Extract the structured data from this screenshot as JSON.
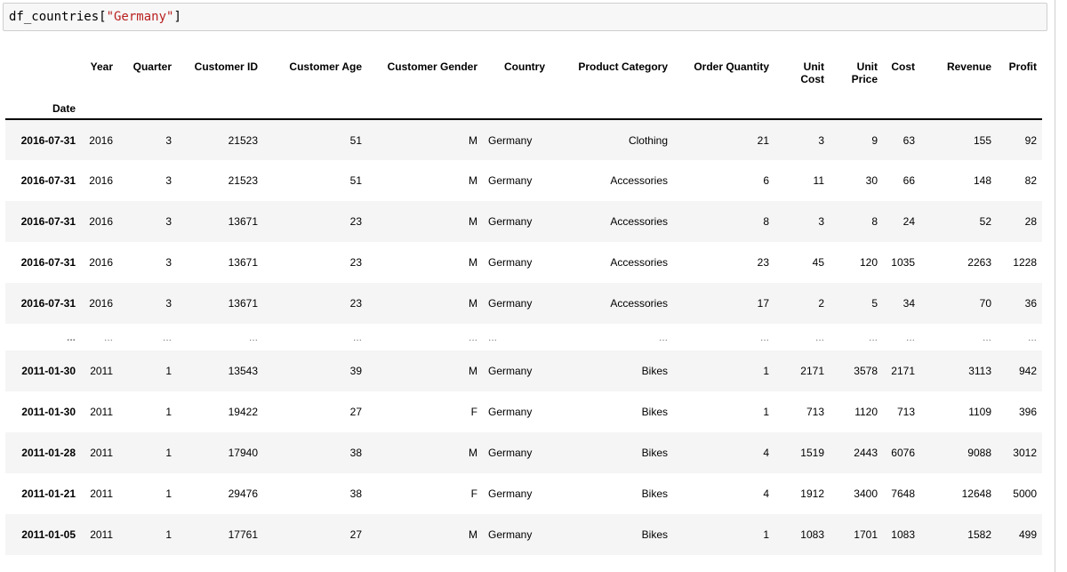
{
  "cell": {
    "code_prefix": "df_countries[",
    "code_string": "\"Germany\"",
    "code_suffix": "]"
  },
  "table": {
    "index_name": "Date",
    "columns": [
      "Year",
      "Quarter",
      "Customer ID",
      "Customer Age",
      "Customer Gender",
      "Country",
      "Product Category",
      "Order Quantity",
      "Unit Cost",
      "Unit Price",
      "Cost",
      "Revenue",
      "Profit"
    ],
    "rows": [
      {
        "date": "2016-07-31",
        "cells": [
          "2016",
          "3",
          "21523",
          "51",
          "M",
          "Germany",
          "Clothing",
          "21",
          "3",
          "9",
          "63",
          "155",
          "92"
        ]
      },
      {
        "date": "2016-07-31",
        "cells": [
          "2016",
          "3",
          "21523",
          "51",
          "M",
          "Germany",
          "Accessories",
          "6",
          "11",
          "30",
          "66",
          "148",
          "82"
        ]
      },
      {
        "date": "2016-07-31",
        "cells": [
          "2016",
          "3",
          "13671",
          "23",
          "M",
          "Germany",
          "Accessories",
          "8",
          "3",
          "8",
          "24",
          "52",
          "28"
        ]
      },
      {
        "date": "2016-07-31",
        "cells": [
          "2016",
          "3",
          "13671",
          "23",
          "M",
          "Germany",
          "Accessories",
          "23",
          "45",
          "120",
          "1035",
          "2263",
          "1228"
        ]
      },
      {
        "date": "2016-07-31",
        "cells": [
          "2016",
          "3",
          "13671",
          "23",
          "M",
          "Germany",
          "Accessories",
          "17",
          "2",
          "5",
          "34",
          "70",
          "36"
        ]
      },
      {
        "date": "...",
        "cells": [
          "...",
          "...",
          "...",
          "...",
          "...",
          "...",
          "...",
          "...",
          "...",
          "...",
          "...",
          "...",
          "..."
        ]
      },
      {
        "date": "2011-01-30",
        "cells": [
          "2011",
          "1",
          "13543",
          "39",
          "M",
          "Germany",
          "Bikes",
          "1",
          "2171",
          "3578",
          "2171",
          "3113",
          "942"
        ]
      },
      {
        "date": "2011-01-30",
        "cells": [
          "2011",
          "1",
          "19422",
          "27",
          "F",
          "Germany",
          "Bikes",
          "1",
          "713",
          "1120",
          "713",
          "1109",
          "396"
        ]
      },
      {
        "date": "2011-01-28",
        "cells": [
          "2011",
          "1",
          "17940",
          "38",
          "M",
          "Germany",
          "Bikes",
          "4",
          "1519",
          "2443",
          "6076",
          "9088",
          "3012"
        ]
      },
      {
        "date": "2011-01-21",
        "cells": [
          "2011",
          "1",
          "29476",
          "38",
          "F",
          "Germany",
          "Bikes",
          "4",
          "1912",
          "3400",
          "7648",
          "12648",
          "5000"
        ]
      },
      {
        "date": "2011-01-05",
        "cells": [
          "2011",
          "1",
          "17761",
          "27",
          "M",
          "Germany",
          "Bikes",
          "1",
          "1083",
          "1701",
          "1083",
          "1582",
          "499"
        ]
      }
    ]
  }
}
